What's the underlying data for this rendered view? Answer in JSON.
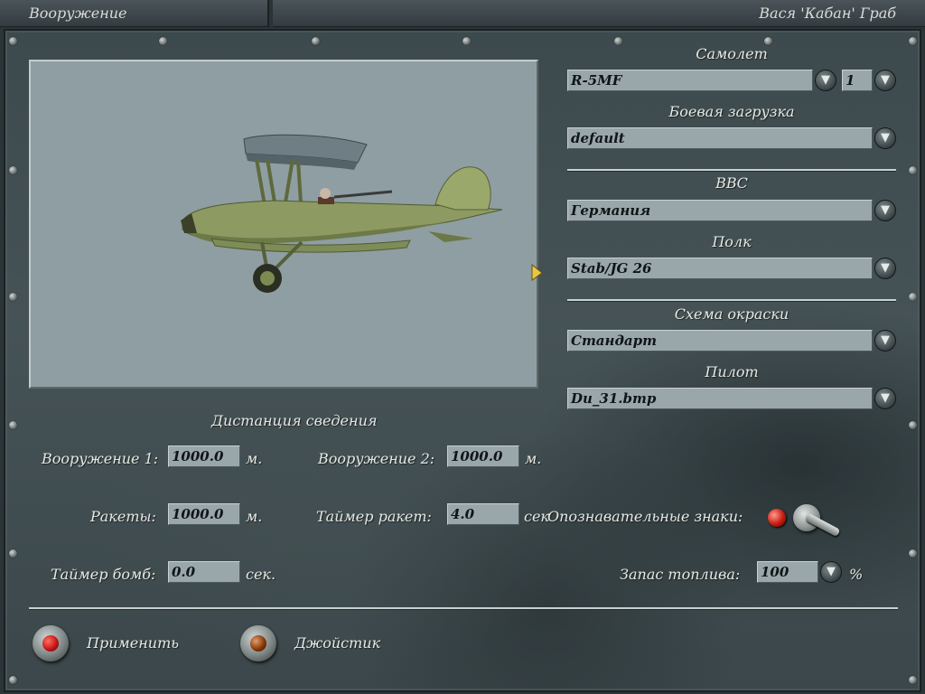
{
  "window": {
    "title": "Вооружение",
    "user": "Вася 'Кабан' Граб"
  },
  "aircraft": {
    "plane_label": "Самолет",
    "plane_value": "R-5MF",
    "count_value": "1",
    "loadout_label": "Боевая загрузка",
    "loadout_value": "default"
  },
  "force": {
    "airforce_label": "ВВС",
    "airforce_value": "Германия",
    "regiment_label": "Полк",
    "regiment_value": "Stab/JG 26"
  },
  "appearance": {
    "skin_label": "Схема окраски",
    "skin_value": "Стандарт",
    "pilot_label": "Пилот",
    "pilot_value": "Du_31.bmp"
  },
  "convergence": {
    "title": "Дистанция сведения",
    "weapon1_label": "Вооружение 1:",
    "weapon1_value": "1000.0",
    "weapon1_unit": "м.",
    "weapon2_label": "Вооружение 2:",
    "weapon2_value": "1000.0",
    "weapon2_unit": "м.",
    "rockets_label": "Ракеты:",
    "rockets_value": "1000.0",
    "rockets_unit": "м.",
    "rocket_timer_label": "Таймер ракет:",
    "rocket_timer_value": "4.0",
    "rocket_timer_unit": "сек",
    "bomb_timer_label": "Таймер бомб:",
    "bomb_timer_value": "0.0",
    "bomb_timer_unit": "сек."
  },
  "markings": {
    "label": "Опознавательные знаки:"
  },
  "fuel": {
    "label": "Запас топлива:",
    "value": "100",
    "unit": "%"
  },
  "actions": {
    "apply_label": "Применить",
    "joystick_label": "Джойстик"
  },
  "colors": {
    "apply_knob": "#c8161a",
    "joystick_knob": "#8a3a08",
    "panel": "#465356"
  }
}
